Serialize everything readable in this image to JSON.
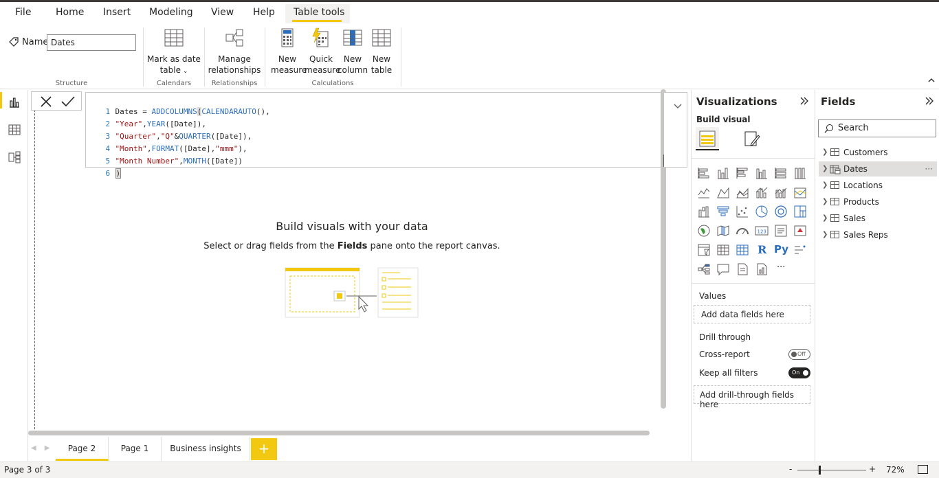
{
  "menu": {
    "tabs": [
      {
        "label": "File"
      },
      {
        "label": "Home"
      },
      {
        "label": "Insert"
      },
      {
        "label": "Modeling"
      },
      {
        "label": "View"
      },
      {
        "label": "Help"
      },
      {
        "label": "Table tools"
      }
    ],
    "active_tab": "Table tools"
  },
  "ribbon": {
    "name_label": "Name",
    "name_value": "Dates",
    "structure_label": "Structure",
    "mark_date_line1": "Mark as date",
    "mark_date_line2": "table",
    "calendars_label": "Calendars",
    "manage_rel_line1": "Manage",
    "manage_rel_line2": "relationships",
    "relationships_label": "Relationships",
    "new_measure_line1": "New",
    "new_measure_line2": "measure",
    "quick_measure_line1": "Quick",
    "quick_measure_line2": "measure",
    "new_column_line1": "New",
    "new_column_line2": "column",
    "new_table_line1": "New",
    "new_table_line2": "table",
    "calculations_label": "Calculations"
  },
  "formula": {
    "lines": [
      {
        "num": "1",
        "parts": [
          [
            "id",
            "Dates = "
          ],
          [
            "fn",
            "ADDCOLUMNS"
          ],
          [
            "id",
            "("
          ],
          [
            "fn",
            "CALENDARAUTO"
          ],
          [
            "id",
            "(),"
          ]
        ]
      },
      {
        "num": "2",
        "parts": [
          [
            "str",
            "\"Year\""
          ],
          [
            "id",
            ","
          ],
          [
            "fn",
            "YEAR"
          ],
          [
            "id",
            "([Date]),"
          ]
        ]
      },
      {
        "num": "3",
        "parts": [
          [
            "str",
            "\"Quarter\""
          ],
          [
            "id",
            ","
          ],
          [
            "str",
            "\"Q\""
          ],
          [
            "id",
            "&"
          ],
          [
            "fn",
            "QUARTER"
          ],
          [
            "id",
            "([Date]),"
          ]
        ]
      },
      {
        "num": "4",
        "parts": [
          [
            "str",
            "\"Month\""
          ],
          [
            "id",
            ","
          ],
          [
            "fn",
            "FORMAT"
          ],
          [
            "id",
            "([Date],"
          ],
          [
            "str",
            "\"mmm\""
          ],
          [
            "id",
            "),"
          ]
        ]
      },
      {
        "num": "5",
        "parts": [
          [
            "str",
            "\"Month Number\""
          ],
          [
            "id",
            ","
          ],
          [
            "fn",
            "MONTH"
          ],
          [
            "id",
            "([Date])"
          ]
        ]
      },
      {
        "num": "6",
        "parts": [
          [
            "id",
            ")"
          ]
        ]
      }
    ]
  },
  "canvas": {
    "empty_title": "Build visuals with your data",
    "empty_sub_before": "Select or drag fields from the ",
    "empty_sub_bold": "Fields",
    "empty_sub_after": " pane onto the report canvas."
  },
  "pages": {
    "tabs": [
      {
        "label": "Page 2",
        "active": true
      },
      {
        "label": "Page 1",
        "active": false
      },
      {
        "label": "Business insights",
        "active": false
      }
    ],
    "add_label": "+"
  },
  "status": {
    "page_info": "Page 3 of 3",
    "zoom_minus": "-",
    "zoom_plus": "+",
    "zoom_pct": "72%"
  },
  "visualizations": {
    "title": "Visualizations",
    "build_label": "Build visual",
    "values_label": "Values",
    "values_placeholder": "Add data fields here",
    "drill_label": "Drill through",
    "cross_report_label": "Cross-report",
    "cross_report_state": "Off",
    "keep_filters_label": "Keep all filters",
    "keep_filters_state": "On",
    "drill_placeholder": "Add drill-through fields here",
    "r_label": "R",
    "py_label": "Py",
    "more_label": "···"
  },
  "fields": {
    "title": "Fields",
    "search_placeholder": "Search",
    "tables": [
      {
        "label": "Customers",
        "selected": false
      },
      {
        "label": "Dates",
        "selected": true
      },
      {
        "label": "Locations",
        "selected": false
      },
      {
        "label": "Products",
        "selected": false
      },
      {
        "label": "Sales",
        "selected": false
      },
      {
        "label": "Sales Reps",
        "selected": false
      }
    ],
    "more_label": "···"
  },
  "colors": {
    "accent": "#f2c811",
    "function": "#2b6dbd",
    "string": "#a31515"
  }
}
